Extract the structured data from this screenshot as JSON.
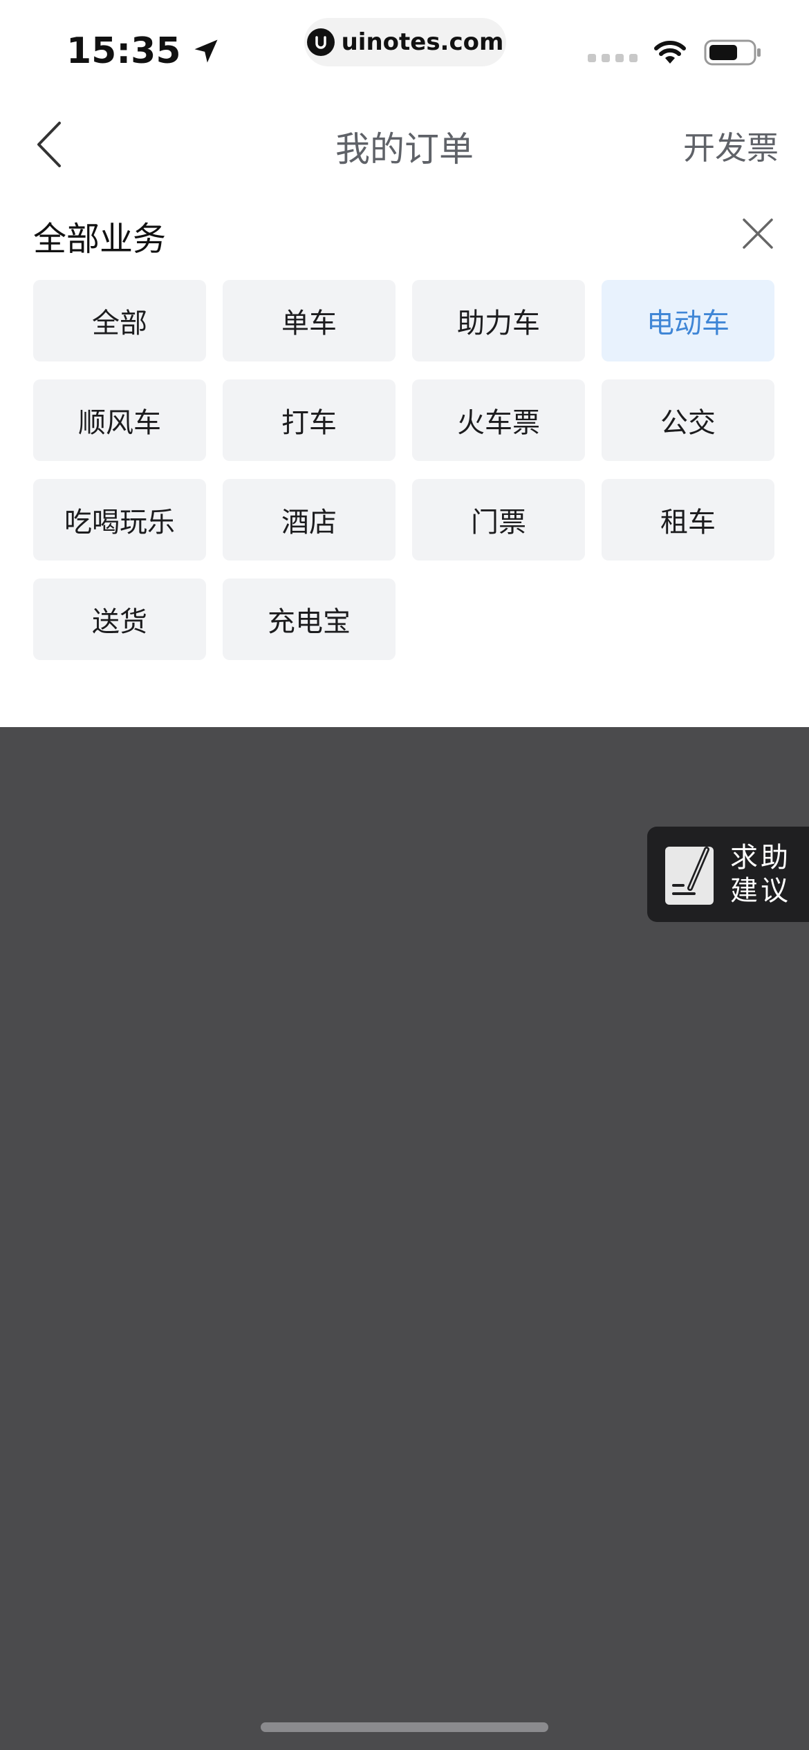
{
  "status_bar": {
    "time": "15:35",
    "url": "uinotes.com"
  },
  "nav": {
    "title": "我的订单",
    "action": "开发票"
  },
  "filter": {
    "title": "全部业务",
    "options": [
      "全部",
      "单车",
      "助力车",
      "电动车",
      "顺风车",
      "打车",
      "火车票",
      "公交",
      "吃喝玩乐",
      "酒店",
      "门票",
      "租车",
      "送货",
      "充电宝"
    ],
    "selected": "电动车"
  },
  "help": {
    "line1": "求助",
    "line2": "建议"
  },
  "colors": {
    "accent": "#3f86d6",
    "chip_bg": "#f2f3f5",
    "chip_active_bg": "#e8f2fd",
    "overlay": "#4b4b4d"
  }
}
